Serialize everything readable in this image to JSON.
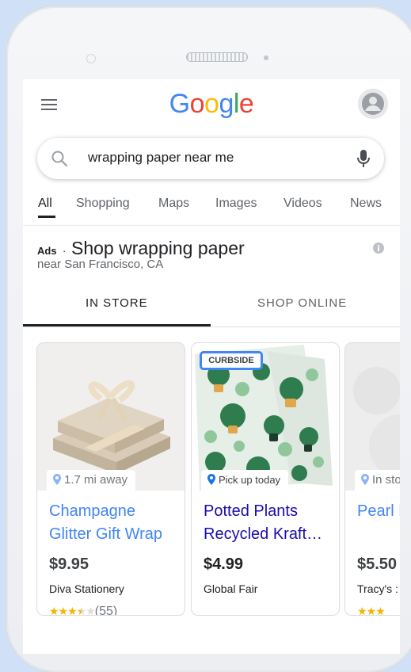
{
  "search": {
    "query": "wrapping paper near me"
  },
  "tabs": [
    "All",
    "Shopping",
    "Maps",
    "Images",
    "Videos",
    "News"
  ],
  "ads": {
    "label": "Ads",
    "dot": "·",
    "title": "Shop wrapping paper",
    "subtitle": "near San Francisco, CA"
  },
  "store_tabs": {
    "in_store": "IN STORE",
    "online": "SHOP ONLINE"
  },
  "products": [
    {
      "badge": "1.7 mi away",
      "title": "Champagne Glitter Gift Wrap",
      "price": "$9.95",
      "store": "Diva Stationery",
      "rating": 3.5,
      "reviews": "(55)"
    },
    {
      "tag": "CURBSIDE",
      "badge": "Pick up today",
      "title": "Potted Plants Recycled Kraft…",
      "price": "$4.99",
      "store": "Global Fair"
    },
    {
      "badge": "In sto",
      "title": "Pearl Eucal",
      "price": "$5.50",
      "store": "Tracy's :"
    }
  ],
  "colors": {
    "google_blue": "#4285F4",
    "google_red": "#EA4335",
    "google_yellow": "#FBBC05",
    "google_green": "#34A853",
    "link_visited": "#4285F4",
    "link": "#1A0DAB"
  }
}
